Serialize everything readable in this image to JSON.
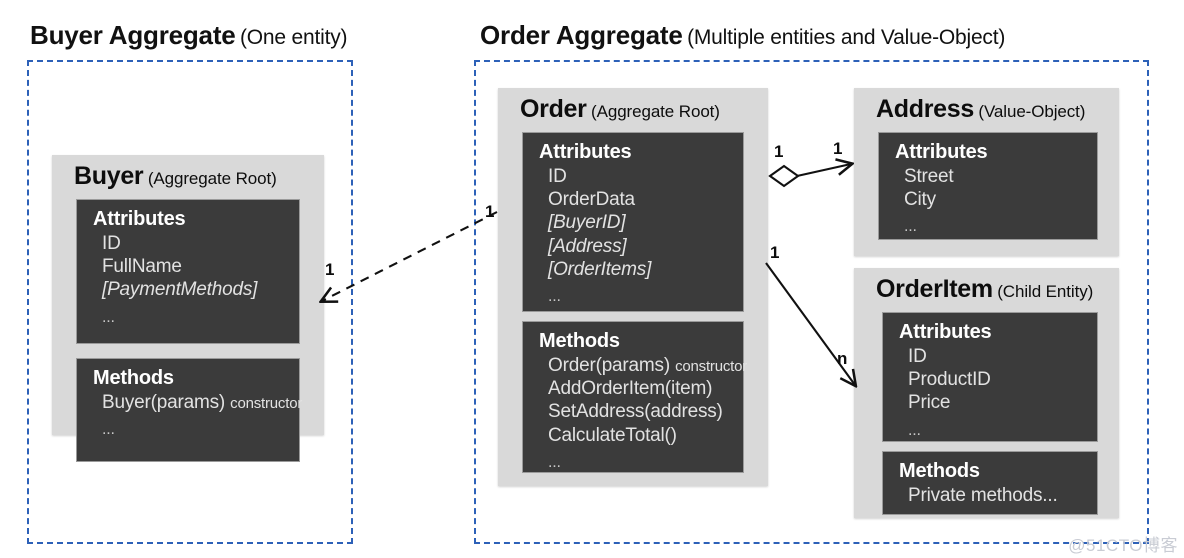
{
  "diagram": {
    "title_left": "Buyer Aggregate",
    "title_left_note": "(One entity)",
    "title_right": "Order Aggregate",
    "title_right_note": "(Multiple entities and Value-Object)",
    "watermark": "@51CTO博客",
    "colors": {
      "boundary": "#2d61b8",
      "card_bg": "#d9d9d9",
      "panel_bg": "#3b3b3b",
      "panel_text": "#e2e2e2",
      "heading_text": "#ffffff"
    }
  },
  "cards": {
    "buyer": {
      "name": "Buyer",
      "stereotype": "(Aggregate Root)",
      "attributes": {
        "heading": "Attributes",
        "items": [
          "ID",
          "FullName",
          "[PaymentMethods]"
        ],
        "italic_from": 2,
        "ellipsis": "..."
      },
      "methods": {
        "heading": "Methods",
        "items": [
          "Buyer(params)"
        ],
        "item_suffix": "constructor",
        "ellipsis": "..."
      }
    },
    "order": {
      "name": "Order",
      "stereotype": "(Aggregate Root)",
      "attributes": {
        "heading": "Attributes",
        "items": [
          "ID",
          "OrderData",
          "[BuyerID]",
          "[Address]",
          "[OrderItems]"
        ],
        "italic_from": 2,
        "ellipsis": "..."
      },
      "methods": {
        "heading": "Methods",
        "items": [
          "Order(params)",
          "AddOrderItem(item)",
          "SetAddress(address)",
          "CalculateTotal()"
        ],
        "item_suffix": "constructor",
        "ellipsis": "..."
      }
    },
    "address": {
      "name": "Address",
      "stereotype": "(Value-Object)",
      "attributes": {
        "heading": "Attributes",
        "items": [
          "Street",
          "City"
        ],
        "ellipsis": "..."
      }
    },
    "orderitem": {
      "name": "OrderItem",
      "stereotype": "(Child Entity)",
      "attributes": {
        "heading": "Attributes",
        "items": [
          "ID",
          "ProductID",
          "Price"
        ],
        "ellipsis": "..."
      },
      "methods": {
        "heading": "Methods",
        "items": [
          "Private methods..."
        ]
      }
    }
  },
  "connectors": {
    "order_to_buyer": {
      "source_label": "1",
      "target_label": "1",
      "style": "dashed-arrow"
    },
    "order_to_address": {
      "source_label": "1",
      "target_label": "1",
      "style": "aggregation-diamond"
    },
    "order_to_orderitem": {
      "source_label": "1",
      "target_label": "n",
      "style": "solid-arrow"
    }
  }
}
